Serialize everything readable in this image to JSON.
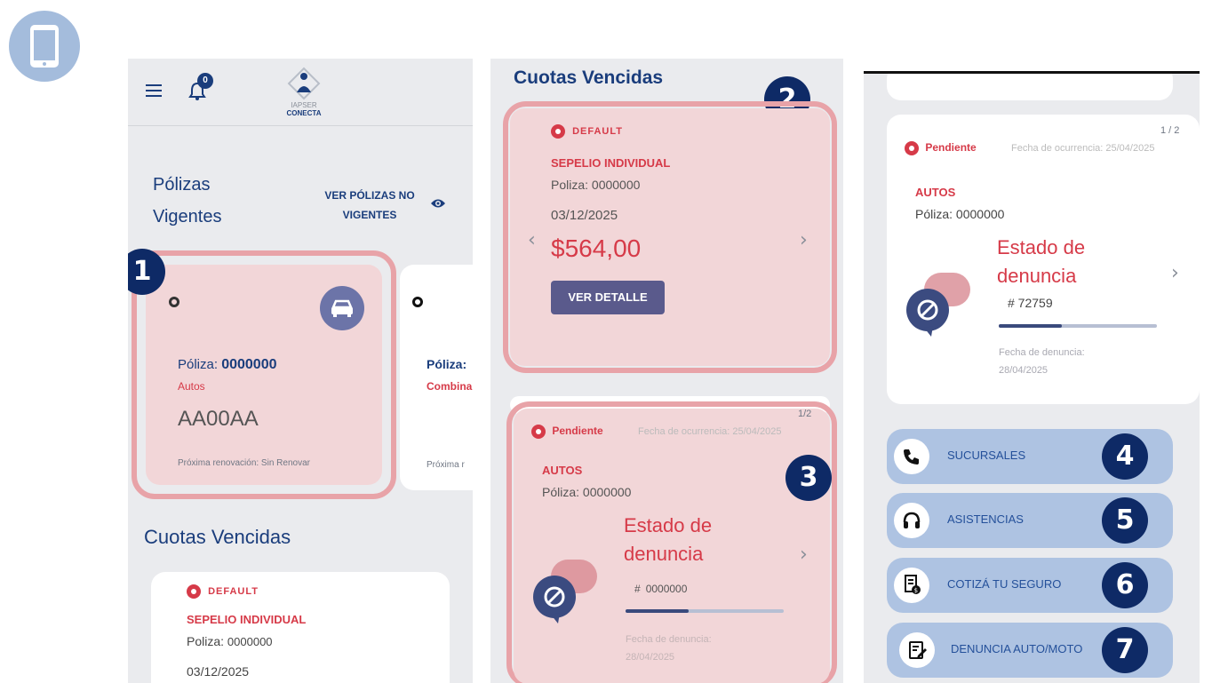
{
  "screen1": {
    "notif_count": "0",
    "logo_line1": "IAPSER",
    "logo_line2": "CONECTA",
    "section_title_line1": "Pólizas",
    "section_title_line2": "Vigentes",
    "link_line1": "VER PÓLIZAS NO",
    "link_line2": "VIGENTES",
    "badge": "1",
    "policy_card": {
      "label": "Póliza:",
      "number": "0000000",
      "type": "Autos",
      "plate": "AA00AA",
      "renewal": "Próxima renovación: Sin Renovar"
    },
    "second_card": {
      "label": "Póliza: ",
      "type": "Combina",
      "renewal": "Próxima r"
    },
    "cuotas_title": "Cuotas Vencidas",
    "cuota": {
      "status": "DEFAULT",
      "product": "SEPELIO INDIVIDUAL",
      "poliza_label": "Poliza:",
      "poliza_number": "0000000",
      "date": "03/12/2025"
    }
  },
  "screen2": {
    "title": "Cuotas Vencidas",
    "badge2": "2",
    "badge3": "3",
    "cuota": {
      "status": "DEFAULT",
      "product": "SEPELIO INDIVIDUAL",
      "poliza": "Poliza: 0000000",
      "date": "03/12/2025",
      "amount": "$564,00",
      "button": "VER DETALLE"
    },
    "claim": {
      "pager": "1/2",
      "status": "Pendiente",
      "occurrence": "Fecha de ocurrencia: 25/04/2025",
      "type": "AUTOS",
      "poliza_label": "Póliza:",
      "poliza_number": "0000000",
      "state_line1": "Estado de",
      "state_line2": "denuncia",
      "hash": "#",
      "number": "0000000",
      "denuncia_label": "Fecha de denuncia:",
      "denuncia_date": "28/04/2025",
      "progress": 0.4
    }
  },
  "screen3": {
    "claim": {
      "pager": "1 / 2",
      "status": "Pendiente",
      "occurrence": "Fecha de ocurrencia: 25/04/2025",
      "type": "AUTOS",
      "poliza_label": "Póliza:",
      "poliza_number": "0000000",
      "state_line1": "Estado de",
      "state_line2": "denuncia",
      "number": "# 72759",
      "denuncia_label": "Fecha de denuncia:",
      "denuncia_date": "28/04/2025",
      "progress": 0.4
    },
    "buttons": [
      {
        "label": "SUCURSALES",
        "badge": "4",
        "icon": "phone-icon"
      },
      {
        "label": "ASISTENCIAS",
        "badge": "5",
        "icon": "headset-icon"
      },
      {
        "label": "COTIZÁ TU SEGURO",
        "badge": "6",
        "icon": "quote-document-icon"
      },
      {
        "label": "DENUNCIA AUTO/MOTO",
        "badge": "7",
        "icon": "edit-document-icon"
      }
    ]
  },
  "colors": {
    "navy": "#1a3d7c",
    "red": "#d63a48",
    "highlight": "#f2d6d8",
    "badge": "#0e2a66",
    "action_button": "#aec3e2"
  }
}
